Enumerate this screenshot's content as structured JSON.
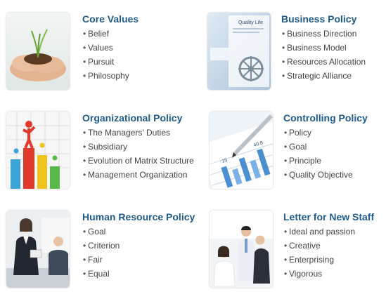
{
  "bullet": "•",
  "sections": [
    {
      "title": "Core Values",
      "image": "hands-holding-seedling-photo",
      "items": [
        "Belief",
        "Values",
        "Pursuit",
        "Philosophy"
      ]
    },
    {
      "title": "Business Policy",
      "image": "quality-life-brochure-photo",
      "items": [
        "Business Direction",
        "Business Model",
        "Resources Allocation",
        "Strategic Alliance"
      ]
    },
    {
      "title": "Organizational Policy",
      "image": "figures-on-bar-chart-photo",
      "items": [
        "The Managers' Duties",
        "Subsidiary",
        "Evolution of Matrix Structure",
        "Management Organization"
      ]
    },
    {
      "title": "Controlling Policy",
      "image": "pen-on-financial-chart-photo",
      "items": [
        "Policy",
        "Goal",
        "Principle",
        "Quality Objective"
      ]
    },
    {
      "title": "Human Resource Policy",
      "image": "business-meeting-photo",
      "items": [
        "Goal",
        "Criterion",
        "Fair",
        "Equal"
      ]
    },
    {
      "title": "Letter for New Staff",
      "image": "new-staff-team-photo",
      "items": [
        "Ideal and passion",
        "Creative",
        "Enterprising",
        "Vigorous"
      ]
    }
  ],
  "photo_text": {
    "brochure_title": "Quality Life",
    "chart_value_1": "40.8",
    "chart_value_2": "15"
  }
}
